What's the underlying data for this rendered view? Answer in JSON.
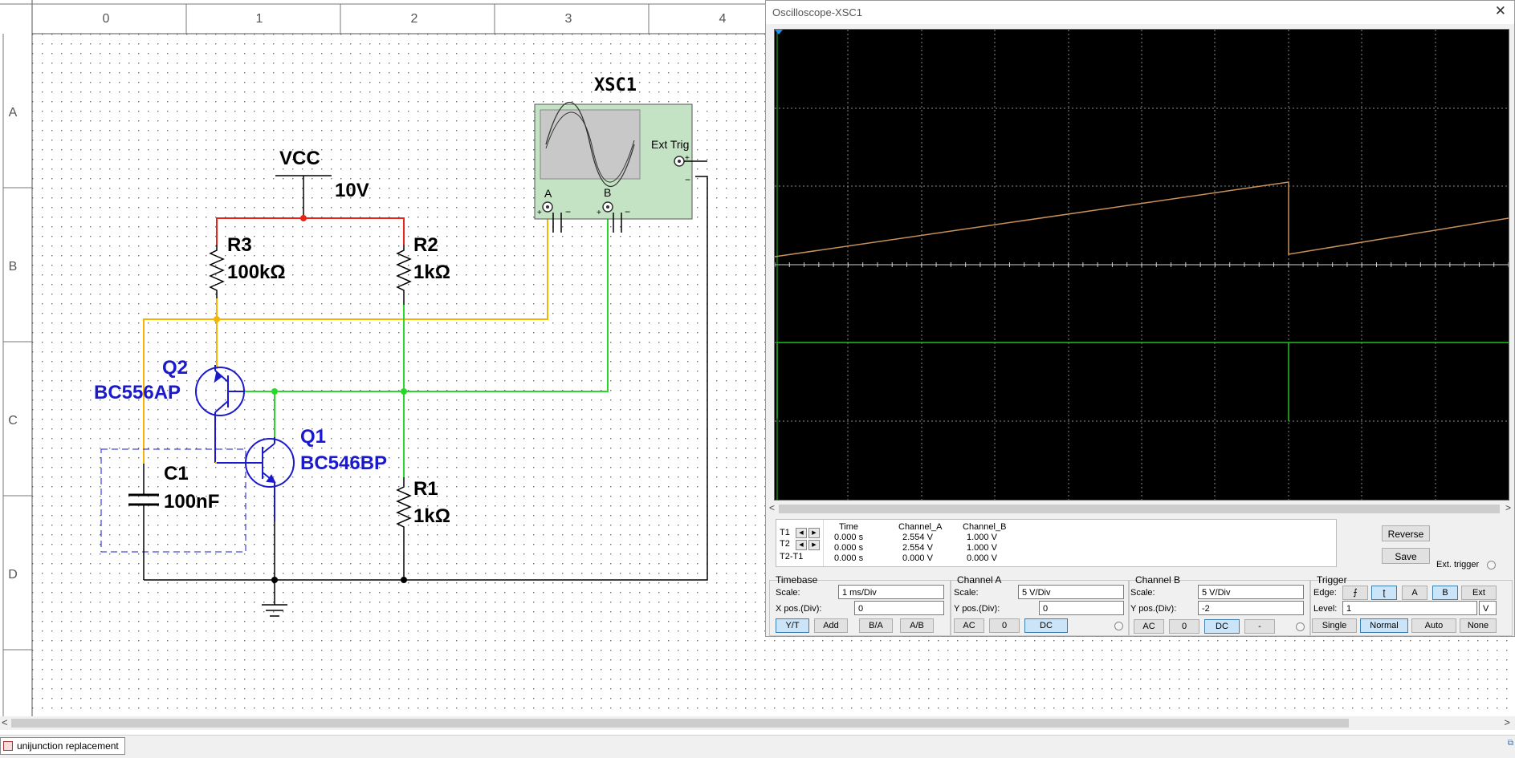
{
  "schematic": {
    "col_headers": [
      "0",
      "1",
      "2",
      "3",
      "4"
    ],
    "row_headers": [
      "A",
      "B",
      "C",
      "D"
    ],
    "vcc_label": "VCC",
    "vcc_value": "10V",
    "r3_name": "R3",
    "r3_value": "100kΩ",
    "r2_name": "R2",
    "r2_value": "1kΩ",
    "r1_name": "R1",
    "r1_value": "1kΩ",
    "q2_name": "Q2",
    "q2_model": "BC556AP",
    "q1_name": "Q1",
    "q1_model": "BC546BP",
    "c1_name": "C1",
    "c1_value": "100nF",
    "xsc_name": "XSC1",
    "ext_trig": "Ext Trig",
    "probe_a": "A",
    "probe_b": "B",
    "plus": "+",
    "minus": "−"
  },
  "oscilloscope": {
    "title": "Oscilloscope-XSC1",
    "readout": {
      "rows": [
        "T1",
        "T2",
        "T2-T1"
      ],
      "headers": [
        "Time",
        "Channel_A",
        "Channel_B"
      ],
      "time": [
        "0.000 s",
        "0.000 s",
        "0.000 s"
      ],
      "channel_a": [
        "2.554 V",
        "2.554 V",
        "0.000 V"
      ],
      "channel_b": [
        "1.000 V",
        "1.000 V",
        "0.000 V"
      ]
    },
    "reverse_label": "Reverse",
    "save_label": "Save",
    "ext_trigger_label": "Ext. trigger",
    "timebase": {
      "title": "Timebase",
      "scale_label": "Scale:",
      "scale_value": "1 ms/Div",
      "xpos_label": "X pos.(Div):",
      "xpos_value": "0",
      "buttons": [
        "Y/T",
        "Add",
        "B/A",
        "A/B"
      ]
    },
    "channel_a": {
      "title": "Channel A",
      "scale_label": "Scale:",
      "scale_value": "5  V/Div",
      "ypos_label": "Y pos.(Div):",
      "ypos_value": "0",
      "buttons": [
        "AC",
        "0",
        "DC"
      ]
    },
    "channel_b": {
      "title": "Channel B",
      "scale_label": "Scale:",
      "scale_value": "5  V/Div",
      "ypos_label": "Y pos.(Div):",
      "ypos_value": "-2",
      "buttons": [
        "AC",
        "0",
        "DC",
        "-"
      ]
    },
    "trigger": {
      "title": "Trigger",
      "edge_label": "Edge:",
      "edge_buttons": [
        "A",
        "B",
        "Ext"
      ],
      "level_label": "Level:",
      "level_value": "1",
      "level_unit": "V",
      "mode_buttons": [
        "Single",
        "Normal",
        "Auto",
        "None"
      ]
    }
  },
  "taskbar": {
    "tab_label": "unijunction replacement"
  },
  "colors": {
    "wire_red": "#e8231a",
    "wire_yellow": "#f5b400",
    "wire_green": "#2bd62b",
    "wire_black": "#000000",
    "component_blue": "#1a1acc",
    "trace_a": "#c8915a",
    "trace_b": "#1fc21f"
  }
}
